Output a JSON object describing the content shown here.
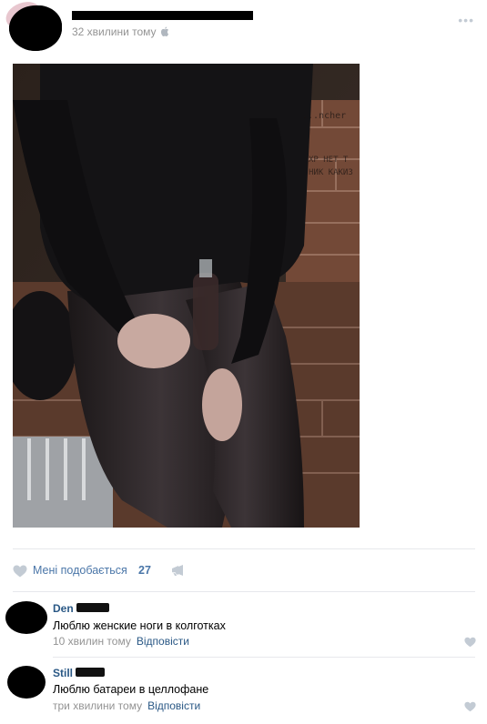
{
  "post": {
    "time": "32 хвилини тому",
    "more": "•••"
  },
  "actions": {
    "like_label": "Мені подобається",
    "like_count": "27"
  },
  "comments": [
    {
      "name": "Den",
      "text": "Люблю женские ноги в колготках",
      "time": "10 хвилин тому",
      "reply": "Відповісти"
    },
    {
      "name": "Still",
      "text": "Люблю батареи в целлофане",
      "time": "три хвилини тому",
      "reply": "Відповісти"
    }
  ],
  "colors": {
    "link": "#2a5885",
    "accent": "#4a76a8",
    "muted": "#939393",
    "icon": "#c3cbd4"
  },
  "icons": {
    "like": "heart-icon",
    "share": "megaphone-icon",
    "device": "apple-icon",
    "more": "more-dots-icon"
  }
}
